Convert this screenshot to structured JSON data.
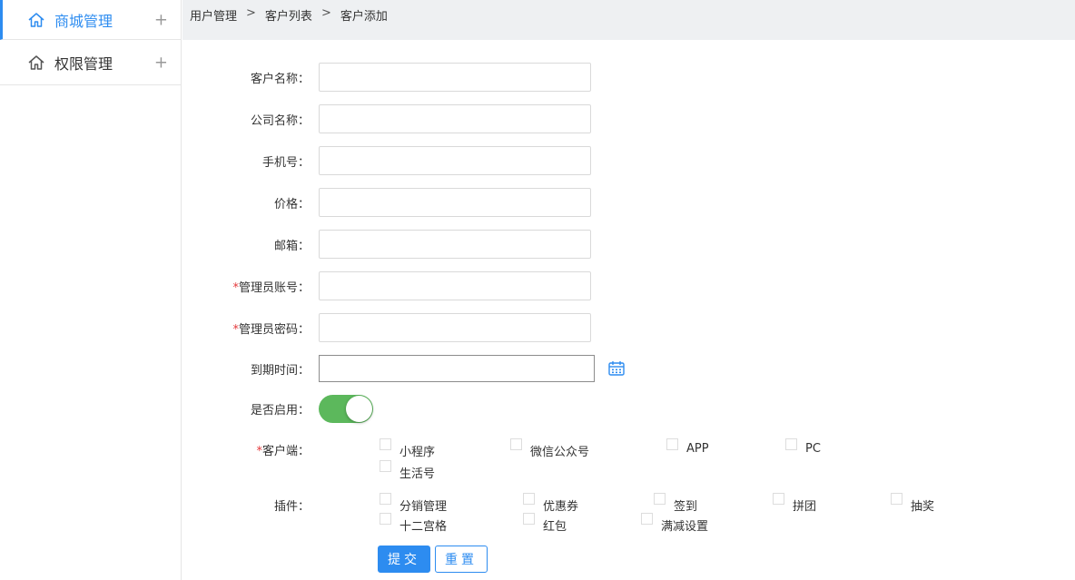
{
  "sidebar": {
    "items": [
      {
        "label": "商城管理",
        "icon": "home-icon"
      },
      {
        "label": "权限管理",
        "icon": "home-icon"
      }
    ],
    "expand_symbol": "+"
  },
  "breadcrumb": {
    "items": [
      "用户管理",
      "客户列表",
      "客户添加"
    ],
    "separator": ">"
  },
  "form": {
    "customer_name_label": "客户名称：",
    "company_name_label": "公司名称：",
    "phone_label": "手机号：",
    "price_label": "价格：",
    "email_label": "邮箱：",
    "required_mark": "*",
    "admin_account_label": "管理员账号：",
    "admin_password_label": "管理员密码：",
    "expire_label": "到期时间：",
    "enabled_label": "是否启用：",
    "enabled": true,
    "client_label": "客户端：",
    "clients": [
      "小程序",
      "微信公众号",
      "APP",
      "PC",
      "生活号"
    ],
    "plugin_label": "插件：",
    "plugins": [
      "分销管理",
      "优惠券",
      "签到",
      "拼团",
      "抽奖",
      "十二宫格",
      "红包",
      "满减设置"
    ],
    "submit_label": "提交",
    "reset_label": "重置"
  },
  "colors": {
    "accent": "#2d8cf0",
    "toggle_on": "#5cb85c",
    "required": "#e4393c"
  }
}
